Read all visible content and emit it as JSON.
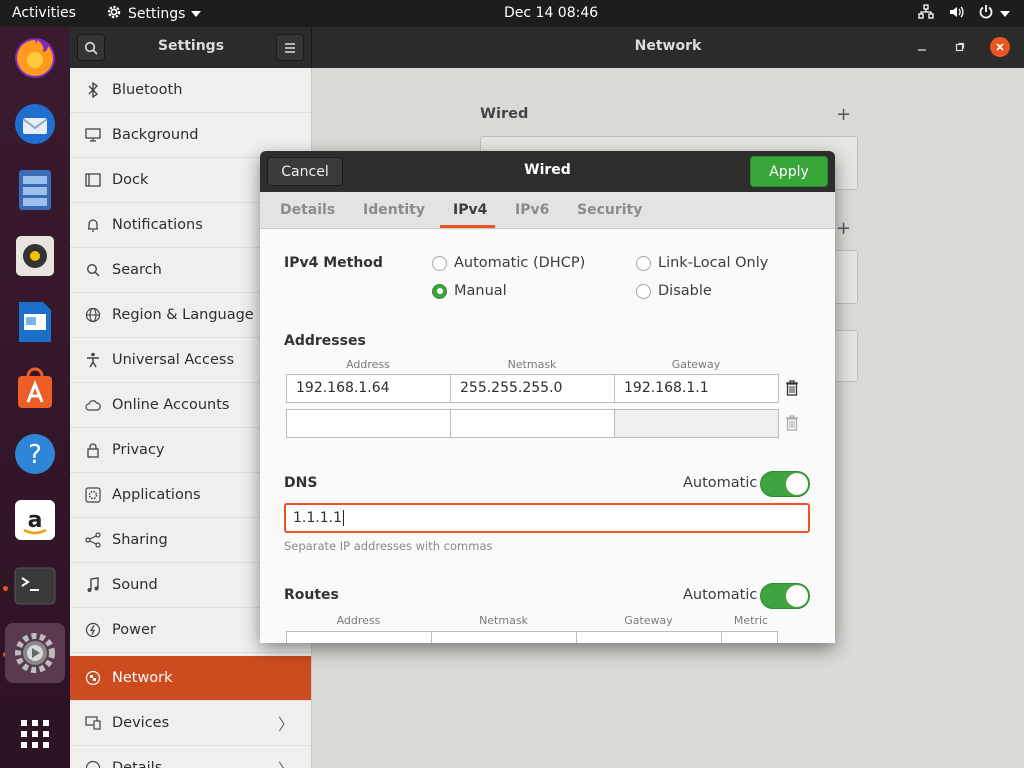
{
  "topbar": {
    "activities": "Activities",
    "app_name": "Settings",
    "clock": "Dec 14  08:46"
  },
  "dock": {
    "apps": [
      "firefox-icon",
      "thunderbird-icon",
      "files-icon",
      "rhythmbox-icon",
      "writer-icon",
      "software-icon",
      "help-icon",
      "amazon-icon",
      "terminal-icon",
      "settings-icon"
    ],
    "show_apps_label": "Show Applications"
  },
  "window": {
    "sidebar_title": "Settings",
    "page_title": "Network"
  },
  "sidebar": {
    "items": [
      {
        "label": "Bluetooth",
        "icon": "bluetooth-icon"
      },
      {
        "label": "Background",
        "icon": "monitor-icon"
      },
      {
        "label": "Dock",
        "icon": "dock-icon"
      },
      {
        "label": "Notifications",
        "icon": "bell-icon"
      },
      {
        "label": "Search",
        "icon": "search-icon"
      },
      {
        "label": "Region & Language",
        "icon": "globe-icon"
      },
      {
        "label": "Universal Access",
        "icon": "accessibility-icon"
      },
      {
        "label": "Online Accounts",
        "icon": "cloud-icon"
      },
      {
        "label": "Privacy",
        "icon": "lock-icon"
      },
      {
        "label": "Applications",
        "icon": "apps-icon"
      },
      {
        "label": "Sharing",
        "icon": "share-icon"
      },
      {
        "label": "Sound",
        "icon": "music-icon"
      },
      {
        "label": "Power",
        "icon": "power-icon"
      },
      {
        "label": "Network",
        "icon": "network-icon",
        "active": true
      },
      {
        "label": "Devices",
        "icon": "devices-icon",
        "has_submenu": true
      },
      {
        "label": "Details",
        "icon": "info-icon",
        "has_submenu": true
      }
    ]
  },
  "background_content": {
    "wired_label": "Wired"
  },
  "dialog": {
    "cancel_label": "Cancel",
    "title": "Wired",
    "apply_label": "Apply",
    "tabs": [
      {
        "label": "Details"
      },
      {
        "label": "Identity"
      },
      {
        "label": "IPv4",
        "active": true
      },
      {
        "label": "IPv6"
      },
      {
        "label": "Security"
      }
    ],
    "ipv4_method": {
      "label": "IPv4 Method",
      "options": [
        {
          "label": "Automatic (DHCP)",
          "selected": false
        },
        {
          "label": "Link-Local Only",
          "selected": false
        },
        {
          "label": "Manual",
          "selected": true
        },
        {
          "label": "Disable",
          "selected": false
        }
      ]
    },
    "addresses": {
      "label": "Addresses",
      "columns": [
        "Address",
        "Netmask",
        "Gateway"
      ],
      "rows": [
        {
          "address": "192.168.1.64",
          "netmask": "255.255.255.0",
          "gateway": "192.168.1.1"
        },
        {
          "address": "",
          "netmask": "",
          "gateway": ""
        }
      ]
    },
    "dns": {
      "label": "DNS",
      "automatic_label": "Automatic",
      "automatic_on": true,
      "value": "1.1.1.1",
      "hint": "Separate IP addresses with commas"
    },
    "routes": {
      "label": "Routes",
      "automatic_label": "Automatic",
      "automatic_on": true,
      "columns": [
        "Address",
        "Netmask",
        "Gateway",
        "Metric"
      ]
    }
  },
  "colors": {
    "accent": "#e95420",
    "toggle_green": "#3fa33f",
    "sidebar_active": "#cc4c1f"
  }
}
